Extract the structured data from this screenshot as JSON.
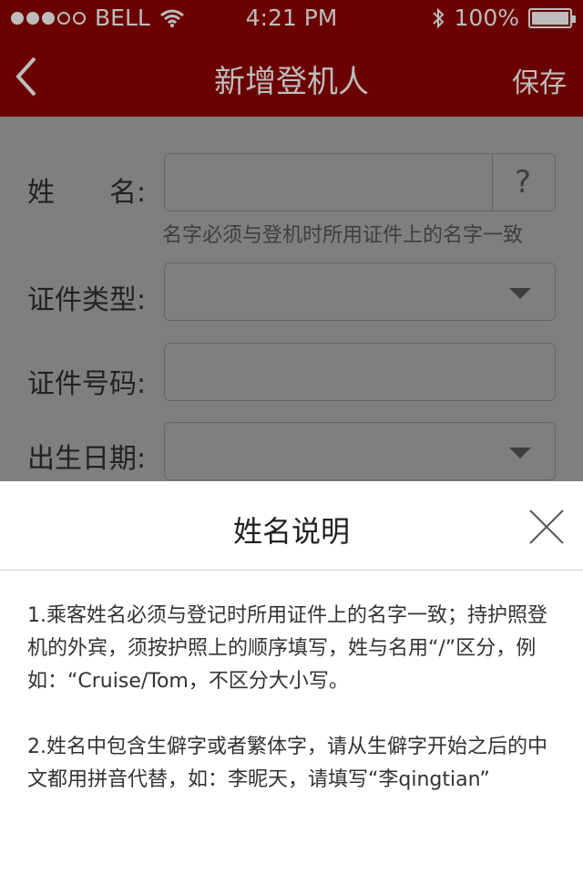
{
  "status_bar": {
    "carrier": "BELL",
    "time": "4:21 PM",
    "battery": "100%"
  },
  "nav": {
    "title": "新增登机人",
    "save": "保存"
  },
  "form": {
    "name_label": "姓　　名:",
    "name_help": "?",
    "name_hint": "名字必须与登机时所用证件上的名字一致",
    "id_type_label": "证件类型:",
    "id_number_label": "证件号码:",
    "birth_label": "出生日期:"
  },
  "panel": {
    "title": "姓名说明",
    "para1": "1.乘客姓名必须与登记时所用证件上的名字一致；持护照登机的外宾，须按护照上的顺序填写，姓与名用“/”区分，例如：“Cruise/Tom，不区分大小写。",
    "para2": "2.姓名中包含生僻字或者繁体字，请从生僻字开始之后的中文都用拼音代替，如：李昵天，请填写“李qingtian”"
  }
}
